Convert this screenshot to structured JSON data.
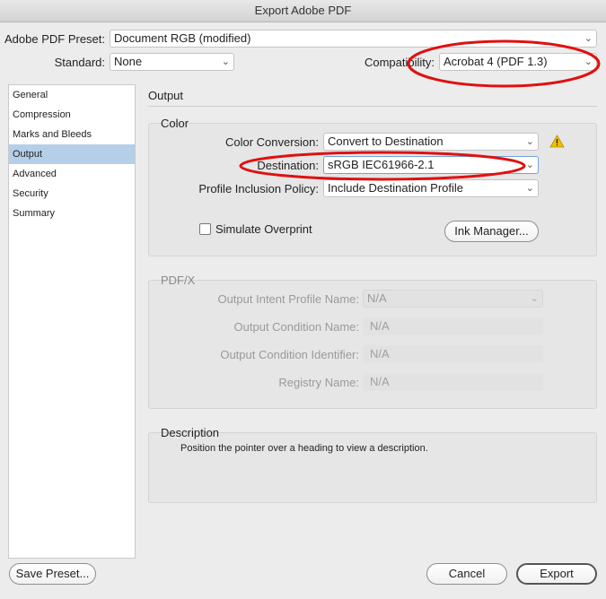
{
  "window": {
    "title": "Export Adobe PDF"
  },
  "preset": {
    "label": "Adobe PDF Preset:",
    "value": "Document RGB (modified)"
  },
  "standard": {
    "label": "Standard:",
    "value": "None"
  },
  "compatibility": {
    "label": "Compatibility:",
    "value": "Acrobat 4 (PDF 1.3)"
  },
  "sidebar": {
    "items": [
      {
        "label": "General"
      },
      {
        "label": "Compression"
      },
      {
        "label": "Marks and Bleeds"
      },
      {
        "label": "Output"
      },
      {
        "label": "Advanced"
      },
      {
        "label": "Security"
      },
      {
        "label": "Summary"
      }
    ],
    "selected": "Output"
  },
  "panel": {
    "title": "Output"
  },
  "color": {
    "title": "Color",
    "conversion_label": "Color Conversion:",
    "conversion_value": "Convert to Destination",
    "destination_label": "Destination:",
    "destination_value": "sRGB IEC61966-2.1",
    "policy_label": "Profile Inclusion Policy:",
    "policy_value": "Include Destination Profile",
    "simulate_label": "Simulate Overprint",
    "ink_manager_label": "Ink Manager..."
  },
  "pdfx": {
    "title": "PDF/X",
    "intent_label": "Output Intent Profile Name:",
    "intent_value": "N/A",
    "condition_label": "Output Condition Name:",
    "condition_value": "N/A",
    "identifier_label": "Output Condition Identifier:",
    "identifier_value": "N/A",
    "registry_label": "Registry Name:",
    "registry_value": "N/A"
  },
  "description": {
    "title": "Description",
    "text": "Position the pointer over a heading to view a description."
  },
  "footer": {
    "save_preset_label": "Save Preset...",
    "cancel_label": "Cancel",
    "export_label": "Export"
  },
  "colors": {
    "annotation": "#e01010",
    "selection": "#b6cfe8",
    "warning": "#f2c200"
  }
}
